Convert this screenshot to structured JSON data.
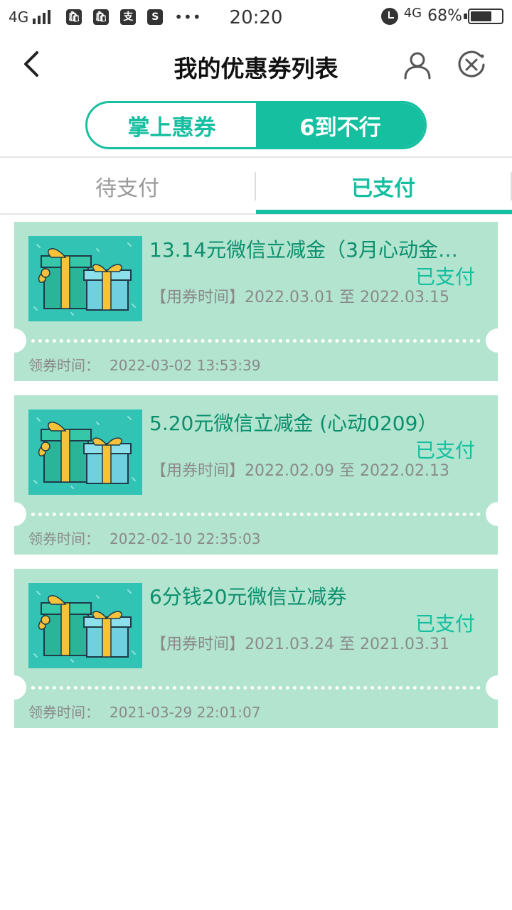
{
  "status_bar": {
    "network": "4G",
    "time": "20:20",
    "network_right": "4G",
    "battery": "68%",
    "battery_fraction": 0.68,
    "app_icons": [
      "bag-icon",
      "bag-icon",
      "alipay-icon",
      "s-icon"
    ],
    "app_glyphs": [
      "🛍",
      "🛍",
      "支",
      "S"
    ],
    "overflow": "•••"
  },
  "header": {
    "title": "我的优惠券列表"
  },
  "segment": {
    "left_label": "掌上惠券",
    "right_label": "6到不行"
  },
  "tabs": {
    "left": "待支付",
    "right": "已支付"
  },
  "coupons": [
    {
      "title": "13.14元微信立减金（3月心动金…",
      "status": "已支付",
      "period_label": "【用券时间】",
      "period_start": "2022.03.01",
      "period_sep": "至",
      "period_end": "2022.03.15",
      "received_label": "领券时间：",
      "received_time": "2022-03-02 13:53:39"
    },
    {
      "title": "5.20元微信立减金 (心动0209）",
      "status": "已支付",
      "period_label": "【用券时间】",
      "period_start": "2022.02.09",
      "period_sep": "至",
      "period_end": "2022.02.13",
      "received_label": "领券时间：",
      "received_time": "2022-02-10 22:35:03"
    },
    {
      "title": "6分钱20元微信立减券",
      "status": "已支付",
      "period_label": "【用券时间】",
      "period_start": "2021.03.24",
      "period_sep": "至",
      "period_end": "2021.03.31",
      "received_label": "领券时间：",
      "received_time": "2021-03-29 22:01:07"
    }
  ],
  "colors": {
    "accent": "#15bfa0",
    "card_bg": "#b2e4cf",
    "thumb_bg": "#32c3b5"
  }
}
